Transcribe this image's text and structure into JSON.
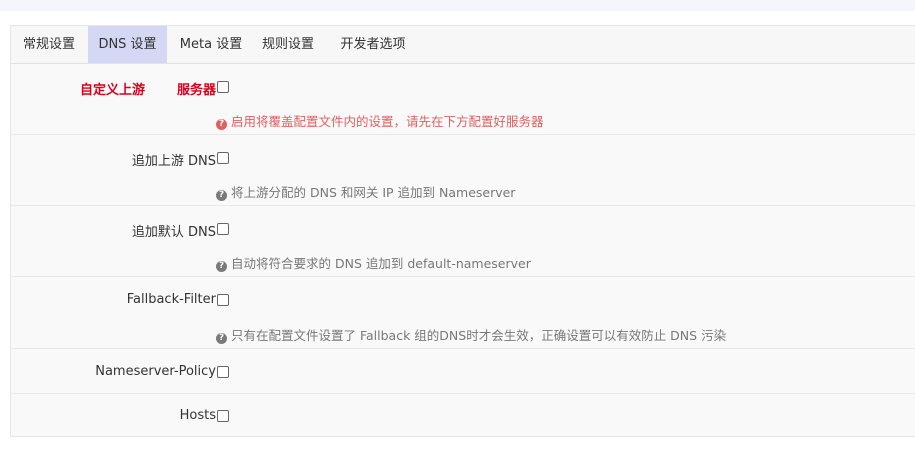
{
  "tabs": [
    {
      "label": "常规设置"
    },
    {
      "label": "DNS 设置"
    },
    {
      "label": "Meta 设置"
    },
    {
      "label": "规则设置"
    },
    {
      "label": "开发者选项"
    }
  ],
  "active_tab": "DNS 设置",
  "settings": [
    {
      "label_part1": "自定义上游",
      "label_part2": "服务器",
      "checked": false,
      "hint": "启用将覆盖配置文件内的设置，请先在下方配置好服务器"
    },
    {
      "label": "追加上游 DNS",
      "checked": false,
      "hint": "将上游分配的 DNS 和网关 IP 追加到 Nameserver"
    },
    {
      "label": "追加默认 DNS",
      "checked": false,
      "hint": "自动将符合要求的 DNS 追加到 default-nameserver"
    },
    {
      "label": "Fallback-Filter",
      "checked": false,
      "hint": "只有在配置文件设置了 Fallback 组的DNS时才会生效，正确设置可以有效防止 DNS 污染"
    },
    {
      "label": "Nameserver-Policy",
      "checked": false
    },
    {
      "label": "Hosts",
      "checked": false
    }
  ],
  "colors": {
    "active_tab_bg": "#d5d8f4",
    "warning_text": "#d9001b",
    "warning_hint": "#e06060"
  },
  "icons": {
    "hint": "question-circle-icon"
  }
}
